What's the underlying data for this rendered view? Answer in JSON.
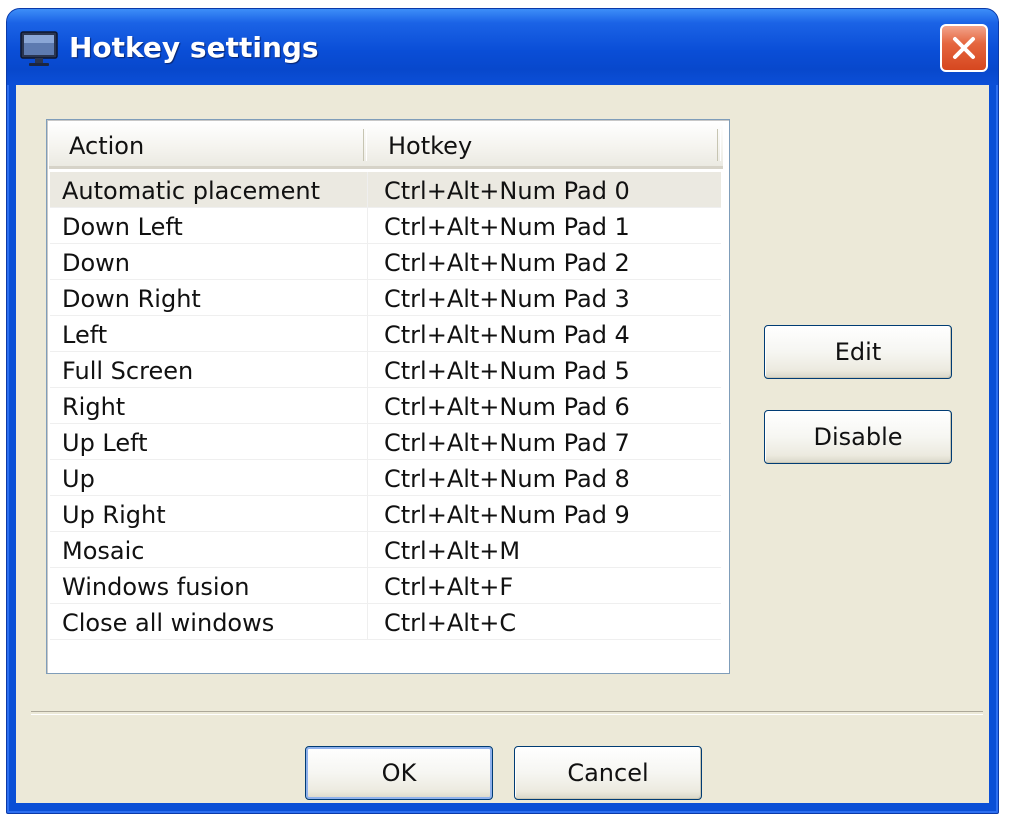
{
  "window": {
    "title": "Hotkey settings",
    "icon": "monitor-icon",
    "close_icon": "close-icon"
  },
  "table": {
    "columns": [
      "Action",
      "Hotkey"
    ],
    "rows": [
      {
        "action": "Automatic placement",
        "hotkey": "Ctrl+Alt+Num Pad 0",
        "selected": true
      },
      {
        "action": "Down Left",
        "hotkey": "Ctrl+Alt+Num Pad 1"
      },
      {
        "action": "Down",
        "hotkey": "Ctrl+Alt+Num Pad 2"
      },
      {
        "action": "Down Right",
        "hotkey": "Ctrl+Alt+Num Pad 3"
      },
      {
        "action": "Left",
        "hotkey": "Ctrl+Alt+Num Pad 4"
      },
      {
        "action": "Full Screen",
        "hotkey": "Ctrl+Alt+Num Pad 5"
      },
      {
        "action": "Right",
        "hotkey": "Ctrl+Alt+Num Pad 6"
      },
      {
        "action": "Up Left",
        "hotkey": "Ctrl+Alt+Num Pad 7"
      },
      {
        "action": "Up",
        "hotkey": "Ctrl+Alt+Num Pad 8"
      },
      {
        "action": "Up Right",
        "hotkey": "Ctrl+Alt+Num Pad 9"
      },
      {
        "action": "Mosaic",
        "hotkey": "Ctrl+Alt+M"
      },
      {
        "action": "Windows fusion",
        "hotkey": "Ctrl+Alt+F"
      },
      {
        "action": "Close all windows",
        "hotkey": "Ctrl+Alt+C"
      }
    ]
  },
  "side_buttons": {
    "edit_label": "Edit",
    "disable_label": "Disable"
  },
  "footer": {
    "ok_label": "OK",
    "cancel_label": "Cancel"
  },
  "colors": {
    "titlebar": "#0a4ed7",
    "client_bg": "#ece9d8",
    "close_button": "#e5663f"
  }
}
